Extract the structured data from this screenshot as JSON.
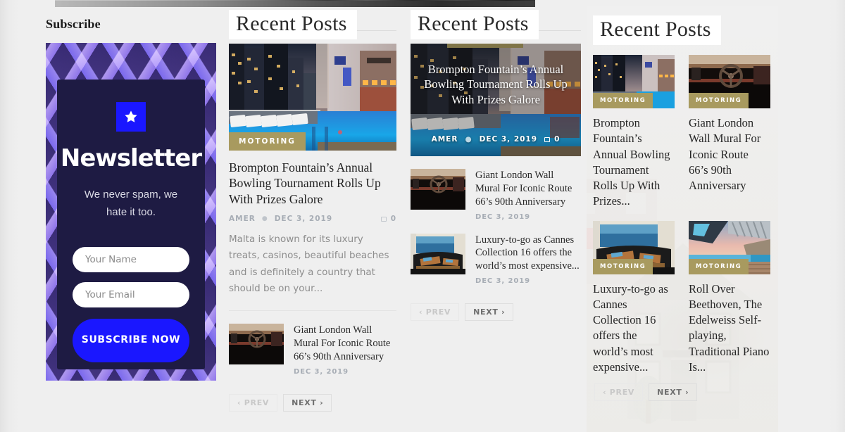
{
  "page": {
    "background_color": "#efefef",
    "accent_category_color": "#a89a5f",
    "accent_blue": "#1a17ff"
  },
  "subscribe_widget": {
    "title": "Subscribe",
    "star_icon": "star-icon",
    "heading": "Newsletter",
    "subtext": "We never spam, we hate it too.",
    "name_placeholder": "Your Name",
    "name_value": "",
    "email_placeholder": "Your Email",
    "email_value": "",
    "button_label": "SUBSCRIBE NOW"
  },
  "recent_posts_classic": {
    "title": "Recent Posts",
    "featured": {
      "category": "MOTORING",
      "title": "Brompton Fountain’s Annual Bowling Tournament Rolls Up With Prizes Galore",
      "author": "AMER",
      "date": "DEC 3, 2019",
      "comments": "0",
      "comment_icon": "comment-icon",
      "excerpt": "Malta is known for its luxury treats, casinos, beautiful beaches and is definitely a country that should be on your..."
    },
    "items": [
      {
        "title": "Giant London Wall Mural For Iconic Route 66’s 90th Anniversary",
        "date": "DEC 3, 2019"
      }
    ],
    "pager": {
      "prev": "‹ PREV",
      "next": "NEXT ›",
      "prev_disabled": true
    }
  },
  "recent_posts_overlay": {
    "title": "Recent Posts",
    "featured": {
      "title": "Brompton Fountain’s Annual Bowling Tournament Rolls Up With Prizes Galore",
      "author": "AMER",
      "date": "DEC 3, 2019",
      "comments": "0",
      "comment_icon": "comment-icon",
      "separator": "●"
    },
    "items": [
      {
        "title": "Giant London Wall Mural For Iconic Route 66’s 90th Anniversary",
        "date": "DEC 3, 2019"
      },
      {
        "title": "Luxury-to-go as Cannes Collection 16 offers the world’s most expensive...",
        "date": "DEC 3, 2019"
      }
    ],
    "pager": {
      "prev": "‹ PREV",
      "next": "NEXT ›",
      "prev_disabled": true
    }
  },
  "recent_posts_grid": {
    "title": "Recent Posts",
    "cards": [
      {
        "category": "MOTORING",
        "title": "Brompton Fountain’s Annual Bowling Tournament Rolls Up With Prizes..."
      },
      {
        "category": "MOTORING",
        "title": "Giant London Wall Mural For Iconic Route 66’s 90th Anniversary"
      },
      {
        "category": "MOTORING",
        "title": "Luxury-to-go as Cannes Collection 16 offers the world’s most expensive..."
      },
      {
        "category": "MOTORING",
        "title": "Roll Over Beethoven, The Edelweiss Self-playing, Traditional Piano Is..."
      }
    ],
    "pager": {
      "prev": "‹ PREV",
      "next": "NEXT ›",
      "prev_disabled": true
    }
  }
}
